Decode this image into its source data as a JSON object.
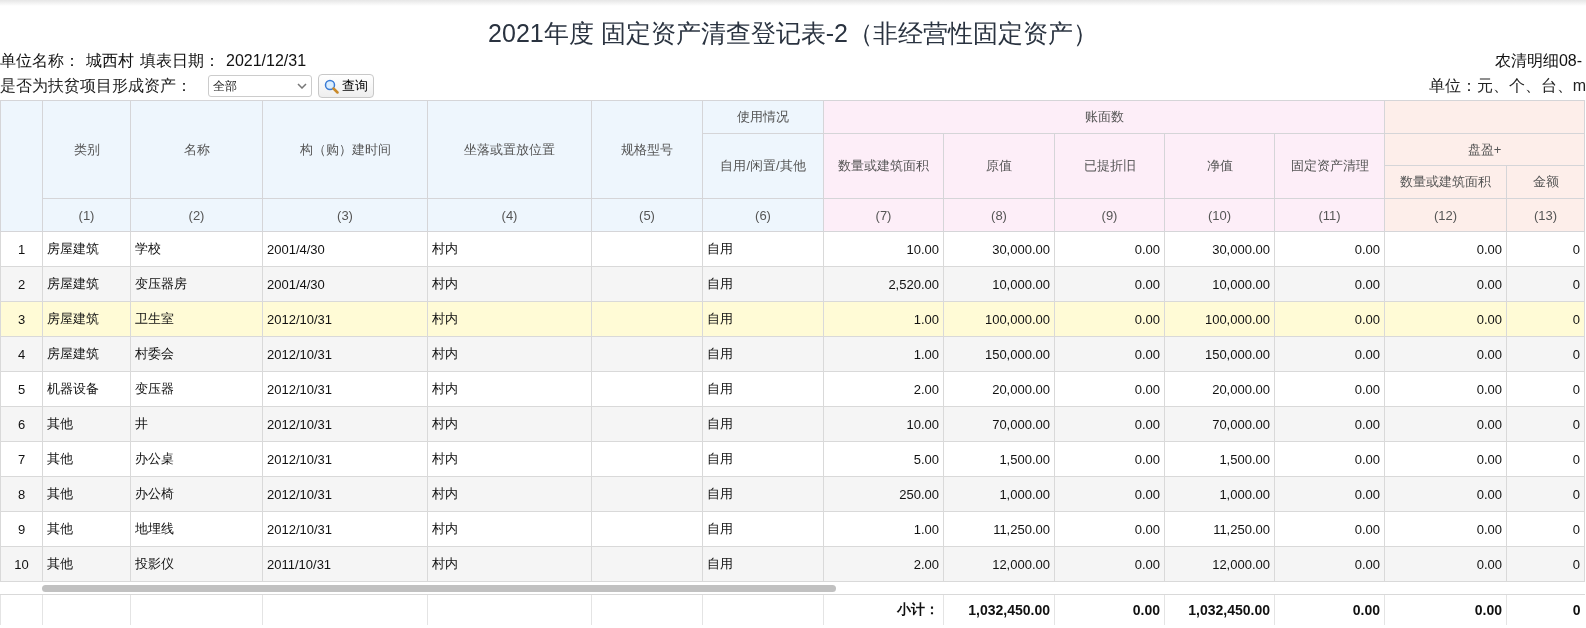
{
  "title": "2021年度 固定资产清查登记表-2（非经营性固定资产）",
  "info": {
    "unit_label": "单位名称：",
    "unit": "城西村",
    "date_label": "填表日期：",
    "date": "2021/12/31",
    "form_code": "农清明细08-"
  },
  "filter": {
    "label": "是否为扶贫项目形成资产：",
    "select_value": "全部",
    "button": "查询",
    "units": "单位：元、个、台、m"
  },
  "header_rows": [
    [
      {
        "rowspan": 4,
        "kind": "basic"
      },
      {
        "text": "类别",
        "rowspan": 3,
        "kind": "basic"
      },
      {
        "text": "名称",
        "rowspan": 3,
        "kind": "basic"
      },
      {
        "text": "构（购）建时间",
        "rowspan": 3,
        "kind": "basic"
      },
      {
        "text": "坐落或置放位置",
        "rowspan": 3,
        "kind": "basic"
      },
      {
        "text": "规格型号",
        "rowspan": 3,
        "kind": "basic"
      },
      {
        "text": "使用情况",
        "kind": "basic"
      },
      {
        "text": "账面数",
        "colspan": 5,
        "kind": "book"
      },
      {
        "colspan": 2,
        "kind": "inventory"
      }
    ],
    [
      {
        "text": "自用/闲置/其他",
        "rowspan": 2,
        "kind": "basic"
      },
      {
        "text": "数量或建筑面积",
        "rowspan": 2,
        "kind": "book"
      },
      {
        "text": "原值",
        "rowspan": 2,
        "kind": "book"
      },
      {
        "text": "已提折旧",
        "rowspan": 2,
        "kind": "book"
      },
      {
        "text": "净值",
        "rowspan": 2,
        "kind": "book"
      },
      {
        "text": "固定资产清理",
        "rowspan": 2,
        "kind": "book"
      },
      {
        "text": "盘盈+",
        "colspan": 2,
        "kind": "inventory"
      }
    ],
    [
      {
        "text": "数量或建筑面积",
        "kind": "inventory"
      },
      {
        "text": "金额",
        "kind": "inventory"
      }
    ],
    [
      {
        "text": "(1)",
        "kind": "basic"
      },
      {
        "text": "(2)",
        "kind": "basic"
      },
      {
        "text": "(3)",
        "kind": "basic"
      },
      {
        "text": "(4)",
        "kind": "basic"
      },
      {
        "text": "(5)",
        "kind": "basic"
      },
      {
        "text": "(6)",
        "kind": "basic"
      },
      {
        "text": "(7)",
        "kind": "book"
      },
      {
        "text": "(8)",
        "kind": "book"
      },
      {
        "text": "(9)",
        "kind": "book"
      },
      {
        "text": "(10)",
        "kind": "book"
      },
      {
        "text": "(11)",
        "kind": "book"
      },
      {
        "text": "(12)",
        "kind": "inventory"
      },
      {
        "text": "(13)",
        "kind": "inventory"
      }
    ]
  ],
  "rows": [
    {
      "num": "1",
      "selected": false,
      "cells": [
        "房屋建筑",
        "学校",
        "2001/4/30",
        "村内",
        "",
        "自用",
        "10.00",
        "30,000.00",
        "0.00",
        "30,000.00",
        "0.00",
        "0.00",
        "0"
      ]
    },
    {
      "num": "2",
      "selected": false,
      "cells": [
        "房屋建筑",
        "变压器房",
        "2001/4/30",
        "村内",
        "",
        "自用",
        "2,520.00",
        "10,000.00",
        "0.00",
        "10,000.00",
        "0.00",
        "0.00",
        "0"
      ]
    },
    {
      "num": "3",
      "selected": true,
      "cells": [
        "房屋建筑",
        "卫生室",
        "2012/10/31",
        "村内",
        "",
        "自用",
        "1.00",
        "100,000.00",
        "0.00",
        "100,000.00",
        "0.00",
        "0.00",
        "0"
      ]
    },
    {
      "num": "4",
      "selected": false,
      "cells": [
        "房屋建筑",
        "村委会",
        "2012/10/31",
        "村内",
        "",
        "自用",
        "1.00",
        "150,000.00",
        "0.00",
        "150,000.00",
        "0.00",
        "0.00",
        "0"
      ]
    },
    {
      "num": "5",
      "selected": false,
      "cells": [
        "机器设备",
        "变压器",
        "2012/10/31",
        "村内",
        "",
        "自用",
        "2.00",
        "20,000.00",
        "0.00",
        "20,000.00",
        "0.00",
        "0.00",
        "0"
      ]
    },
    {
      "num": "6",
      "selected": false,
      "cells": [
        "其他",
        "井",
        "2012/10/31",
        "村内",
        "",
        "自用",
        "10.00",
        "70,000.00",
        "0.00",
        "70,000.00",
        "0.00",
        "0.00",
        "0"
      ]
    },
    {
      "num": "7",
      "selected": false,
      "cells": [
        "其他",
        "办公桌",
        "2012/10/31",
        "村内",
        "",
        "自用",
        "5.00",
        "1,500.00",
        "0.00",
        "1,500.00",
        "0.00",
        "0.00",
        "0"
      ]
    },
    {
      "num": "8",
      "selected": false,
      "cells": [
        "其他",
        "办公椅",
        "2012/10/31",
        "村内",
        "",
        "自用",
        "250.00",
        "1,000.00",
        "0.00",
        "1,000.00",
        "0.00",
        "0.00",
        "0"
      ]
    },
    {
      "num": "9",
      "selected": false,
      "cells": [
        "其他",
        "地埋线",
        "2012/10/31",
        "村内",
        "",
        "自用",
        "1.00",
        "11,250.00",
        "0.00",
        "11,250.00",
        "0.00",
        "0.00",
        "0"
      ]
    },
    {
      "num": "10",
      "selected": false,
      "cells": [
        "其他",
        "投影仪",
        "2011/10/31",
        "村内",
        "",
        "自用",
        "2.00",
        "12,000.00",
        "0.00",
        "12,000.00",
        "0.00",
        "0.00",
        "0"
      ]
    }
  ],
  "subtotal": {
    "label": "小计：",
    "values": [
      "1,032,450.00",
      "0.00",
      "1,032,450.00",
      "0.00",
      "0.00",
      "0"
    ]
  }
}
